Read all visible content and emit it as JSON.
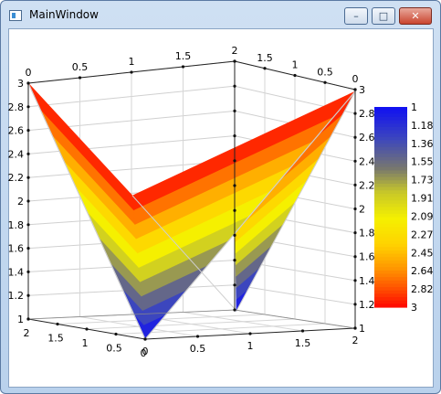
{
  "window": {
    "title": "MainWindow",
    "minimize_label": "–",
    "maximize_label": "□",
    "close_label": "✕"
  },
  "colors": {
    "surface_top": "#ff0000",
    "surface_mid": "#ffee00",
    "surface_bottom": "#1010ff"
  },
  "chart_data": {
    "type": "surface",
    "x_ticks_back": [
      "0",
      "0.5",
      "1",
      "1.5",
      "2",
      "1.5",
      "1",
      "0.5",
      "0"
    ],
    "front_ticks_left": [
      "2",
      "1.5",
      "1",
      "0.5",
      "0"
    ],
    "front_ticks_right": [
      "0",
      "0.5",
      "1",
      "1.5",
      "2"
    ],
    "z_ticks_left": [
      "3",
      "2.8",
      "2.6",
      "2.4",
      "2.2",
      "2",
      "1.8",
      "1.6",
      "1.4",
      "1.2",
      "1"
    ],
    "z_ticks_right": [
      "3",
      "2.8",
      "2.6",
      "2.4",
      "2.2",
      "2",
      "1.8",
      "1.6",
      "1.4",
      "1.2",
      "1"
    ],
    "colorbar_labels": [
      "1",
      "1.18",
      "1.36",
      "1.55",
      "1.73",
      "1.91",
      "2.09",
      "2.27",
      "2.45",
      "2.64",
      "2.82",
      "3"
    ],
    "zlim": [
      1,
      3
    ]
  }
}
